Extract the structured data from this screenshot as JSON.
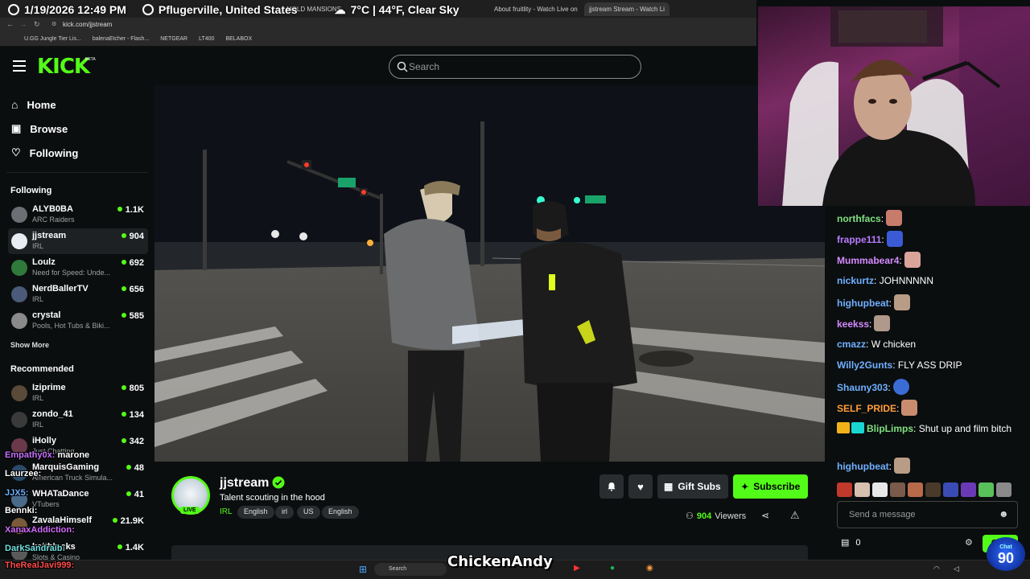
{
  "overlay": {
    "datetime": "1/19/2026 12:49 PM",
    "location": "Pflugerville, United States",
    "weather": "7°C | 44°F, Clear Sky"
  },
  "browser": {
    "tabs": [
      {
        "label": "MOLD MANSIONS"
      },
      {
        "label": "About fruitlity - Watch Live on"
      },
      {
        "label": "jjstream Stream - Watch Li",
        "active": true
      }
    ],
    "url": "kick.com/jjstream",
    "bookmarks": [
      "U.GG Jungle Tier Lis...",
      "balenaEtcher - Flash...",
      "NETGEAR",
      "LT400",
      "BELABOX"
    ]
  },
  "header": {
    "logo": "KICK",
    "logo_badge": "BETA",
    "search_placeholder": "Search"
  },
  "nav": {
    "home": "Home",
    "browse": "Browse",
    "following": "Following"
  },
  "sidebar": {
    "following_title": "Following",
    "following": [
      {
        "name": "ALYB0BA",
        "category": "ARC Raiders",
        "viewers": "1.1K"
      },
      {
        "name": "jjstream",
        "category": "IRL",
        "viewers": "904",
        "selected": true
      },
      {
        "name": "Loulz",
        "category": "Need for Speed: Unde...",
        "viewers": "692"
      },
      {
        "name": "NerdBallerTV",
        "category": "IRL",
        "viewers": "656"
      },
      {
        "name": "crystal",
        "category": "Pools, Hot Tubs & Biki...",
        "viewers": "585"
      }
    ],
    "show_more": "Show More",
    "recommended_title": "Recommended",
    "recommended": [
      {
        "name": "Iziprime",
        "category": "IRL",
        "viewers": "805"
      },
      {
        "name": "zondo_41",
        "category": "IRL",
        "viewers": "134"
      },
      {
        "name": "iHolly",
        "category": "Just Chatting",
        "viewers": "342"
      },
      {
        "name": "MarquisGaming",
        "category": "American Truck Simula...",
        "viewers": "48"
      },
      {
        "name": "WHATaDance",
        "category": "VTubers",
        "viewers": "41"
      },
      {
        "name": "ZavalaHimself",
        "category": "IRL",
        "viewers": "21.9K"
      },
      {
        "name": "keithlocks",
        "category": "Slots & Casino",
        "viewers": "1.4K"
      }
    ]
  },
  "stream": {
    "channel": "jjstream",
    "live_label": "LIVE",
    "title": "Talent scouting in the hood",
    "category": "IRL",
    "tags": [
      "English",
      "irl",
      "US",
      "English"
    ],
    "gift_subs": "Gift Subs",
    "subscribe": "Subscribe",
    "viewer_count": "904",
    "viewers_label": "Viewers"
  },
  "chat": {
    "messages": [
      {
        "user": "northfacs",
        "color": "#7fe07f",
        "text": "",
        "emote": "#c77b6b"
      },
      {
        "user": "frappe111",
        "color": "#b77bff",
        "text": "",
        "emote": "#3b5bd6"
      },
      {
        "user": "Mummabear4",
        "color": "#d58aff",
        "text": "",
        "emote": "#d9a59b"
      },
      {
        "user": "nickurtz",
        "color": "#6fb0ff",
        "text": "JOHNNNNN"
      },
      {
        "user": "highupbeat",
        "color": "#6fb0ff",
        "text": "",
        "emote": "#b99c86"
      },
      {
        "user": "keekss",
        "color": "#d58aff",
        "text": "",
        "emote": "#b0998a"
      },
      {
        "user": "cmazz",
        "color": "#6fb0ff",
        "text": "W chicken"
      },
      {
        "user": "Willy2Gunts",
        "color": "#6fb0ff",
        "text": "FLY ASS DRIP"
      },
      {
        "user": "Shauny303",
        "color": "#6fb0ff",
        "text": "",
        "emote": "#3b6cd6"
      },
      {
        "user": "SELF_PRIDE",
        "color": "#ff9c3a",
        "text": "",
        "emote": "#c98c6e"
      },
      {
        "user": "BlipLimps",
        "color": "#7fe07f",
        "text": "Shut up and film bitch"
      },
      {
        "user": "highupbeat",
        "color": "#6fb0ff",
        "text": "",
        "emote": "#b99c86"
      }
    ],
    "input_placeholder": "Send a message",
    "points": "0",
    "chat_button": "Chat"
  },
  "stream_overlay": {
    "messages": [
      {
        "user": "Empathy0x",
        "text": "marone",
        "color": "#c770ff"
      },
      {
        "user": "Laurzee",
        "text": "",
        "color": "#ffffff"
      },
      {
        "user": "JJX5",
        "text": "",
        "color": "#6fb0ff"
      },
      {
        "user": "Bennki",
        "text": "",
        "color": "#ffffff"
      },
      {
        "user": "XanaxAddiction",
        "text": "",
        "color": "#d36bff"
      },
      {
        "user": "DarkSandraib",
        "text": "",
        "color": "#6fe0e0"
      },
      {
        "user": "TheRealJavi999",
        "text": "",
        "color": "#ff4b4b"
      }
    ],
    "watermark": "ChickenAndy",
    "counter": "90",
    "counter_label": "Chat"
  },
  "taskbar": {
    "search": "Search"
  },
  "colors": {
    "accent": "#53fc18",
    "background": "#0b0e0f",
    "panel": "#2a2d30"
  }
}
